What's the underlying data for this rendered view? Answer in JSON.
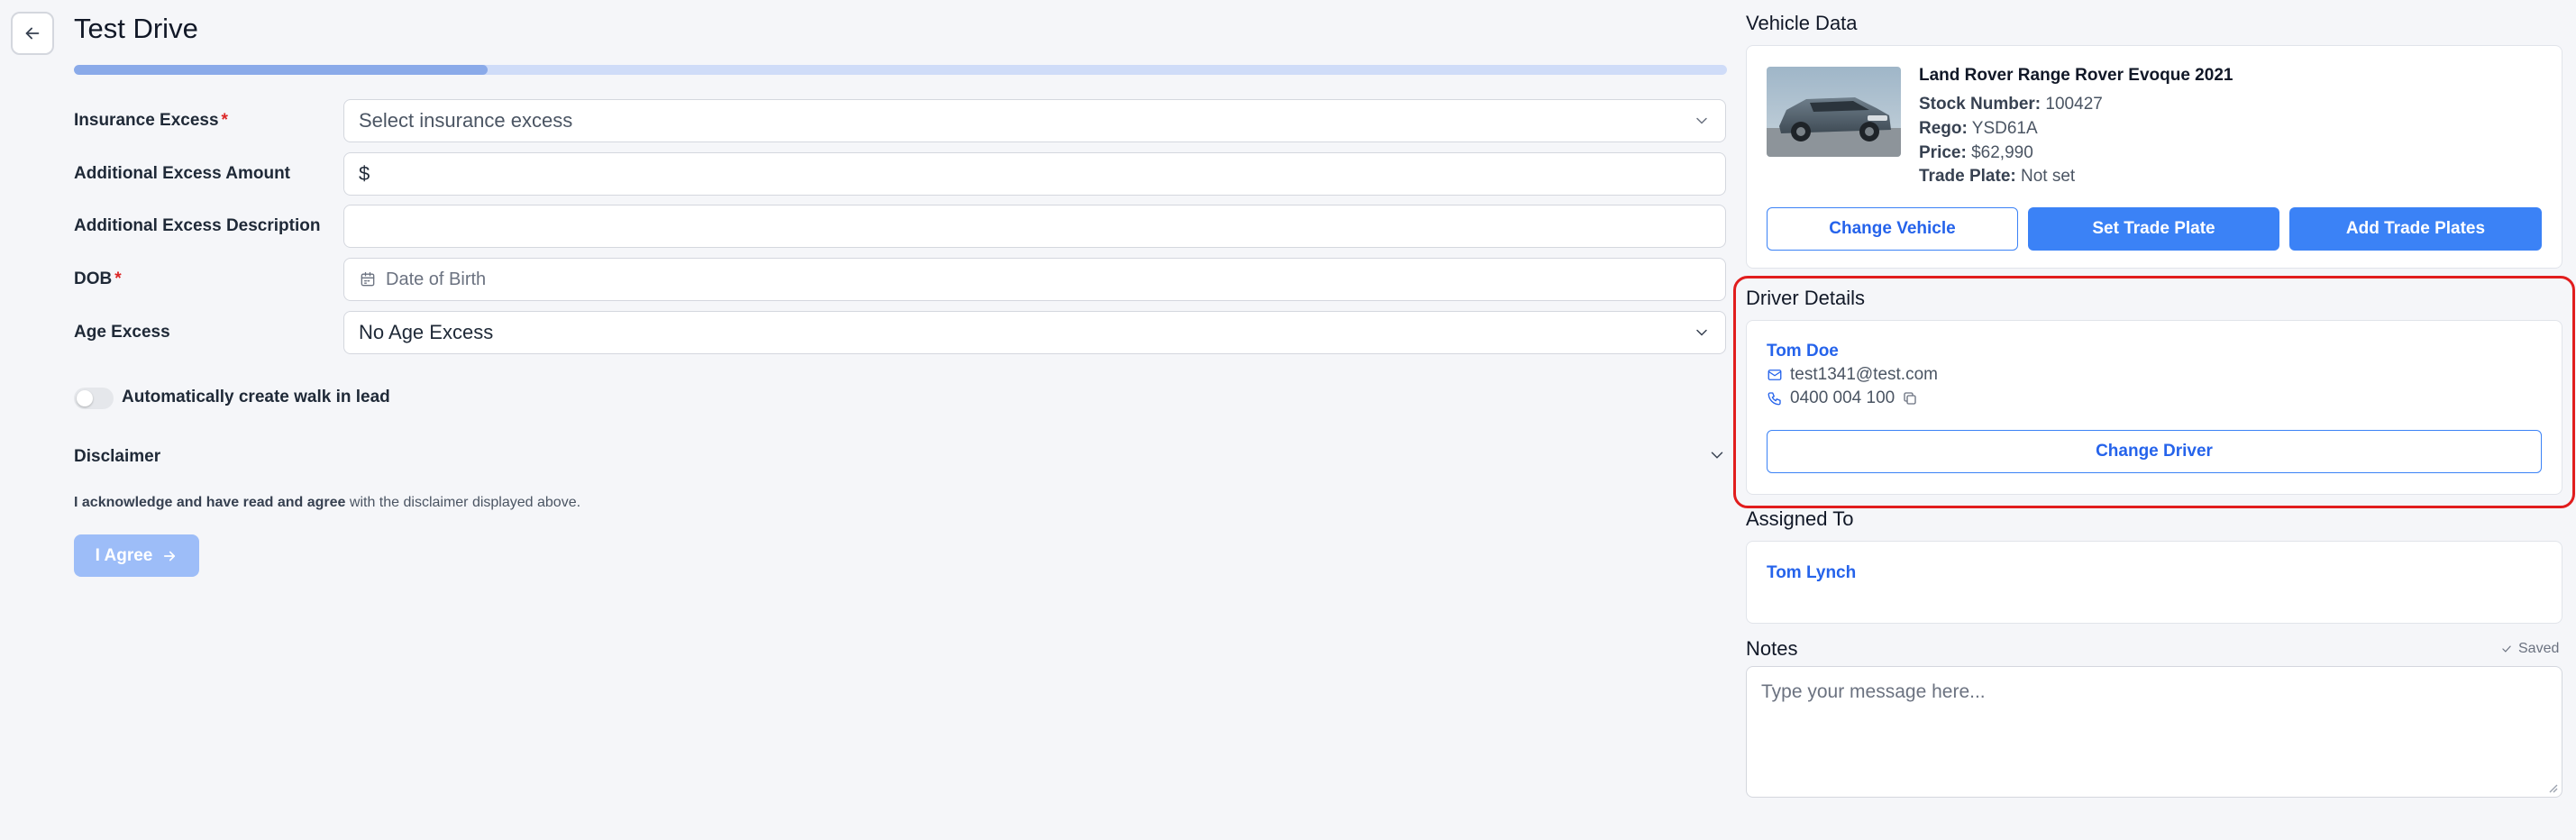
{
  "header": {
    "title": "Test Drive",
    "progress": 0.25
  },
  "form": {
    "insurance_excess": {
      "label": "Insurance Excess",
      "required_mark": "*",
      "placeholder": "Select insurance excess"
    },
    "additional_excess_amount": {
      "label": "Additional Excess Amount",
      "prefix": "$",
      "value": ""
    },
    "additional_excess_description": {
      "label": "Additional Excess Description",
      "value": ""
    },
    "dob": {
      "label": "DOB",
      "required_mark": "*",
      "placeholder": "Date of Birth"
    },
    "age_excess": {
      "label": "Age Excess",
      "value": "No Age Excess"
    },
    "walk_in_toggle": {
      "label": "Automatically create walk in lead",
      "on": false
    },
    "disclaimer": {
      "label": "Disclaimer",
      "ack_bold": "I acknowledge and have read and agree",
      "ack_rest": " with the disclaimer displayed above."
    },
    "agree_button": "I Agree"
  },
  "vehicle": {
    "section_title": "Vehicle Data",
    "name": "Land Rover Range Rover Evoque 2021",
    "stock_label": "Stock Number:",
    "stock_value": "100427",
    "rego_label": "Rego:",
    "rego_value": "YSD61A",
    "price_label": "Price:",
    "price_value": "$62,990",
    "trade_plate_label": "Trade Plate:",
    "trade_plate_value": "Not set",
    "buttons": {
      "change_vehicle": "Change Vehicle",
      "set_trade_plate": "Set Trade Plate",
      "add_trade_plates": "Add Trade Plates"
    }
  },
  "driver": {
    "section_title": "Driver Details",
    "name": "Tom Doe",
    "email": "test1341@test.com",
    "phone": "0400 004 100",
    "change_button": "Change Driver"
  },
  "assigned": {
    "section_title": "Assigned To",
    "name": "Tom Lynch"
  },
  "notes": {
    "section_title": "Notes",
    "status": "Saved",
    "placeholder": "Type your message here..."
  },
  "colors": {
    "accent": "#3b82f6",
    "link": "#2563eb",
    "highlight": "#e11d1d",
    "required": "#dc2626"
  }
}
